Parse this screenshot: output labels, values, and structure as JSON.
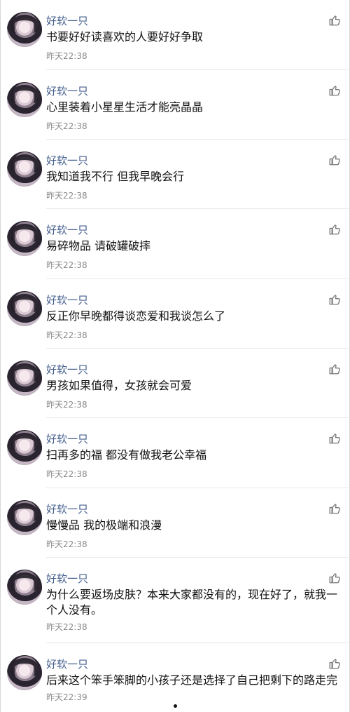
{
  "comments": [
    {
      "username": "好软一只",
      "text": "书要好好读喜欢的人要好好争取",
      "time": "昨天22:38",
      "like_icon": "thumbs-up-icon"
    },
    {
      "username": "好软一只",
      "text": "心里装着小星星生活才能亮晶晶",
      "time": "昨天22:38",
      "like_icon": "thumbs-up-icon"
    },
    {
      "username": "好软一只",
      "text": "我知道我不行 但我早晚会行",
      "time": "昨天22:38",
      "like_icon": "thumbs-up-icon"
    },
    {
      "username": "好软一只",
      "text": "易碎物品 请破罐破摔",
      "time": "昨天22:38",
      "like_icon": "thumbs-up-icon"
    },
    {
      "username": "好软一只",
      "text": "反正你早晚都得谈恋爱和我谈怎么了",
      "time": "昨天22:38",
      "like_icon": "thumbs-up-icon"
    },
    {
      "username": "好软一只",
      "text": "男孩如果值得，女孩就会可爱",
      "time": "昨天22:38",
      "like_icon": "thumbs-up-icon"
    },
    {
      "username": "好软一只",
      "text": "扫再多的福 都没有做我老公幸福",
      "time": "昨天22:38",
      "like_icon": "thumbs-up-icon"
    },
    {
      "username": "好软一只",
      "text": "慢慢品 我的极端和浪漫",
      "time": "昨天22:38",
      "like_icon": "thumbs-up-icon"
    },
    {
      "username": "好软一只",
      "text": "为什么要返场皮肤？本来大家都没有的，现在好了，就我一个人没有。",
      "time": "昨天22:38",
      "like_icon": "thumbs-up-icon"
    },
    {
      "username": "好软一只",
      "text": "后来这个笨手笨脚的小孩子还是选择了自己把剩下的路走完",
      "time": "昨天22:39",
      "like_icon": "thumbs-up-icon"
    }
  ]
}
